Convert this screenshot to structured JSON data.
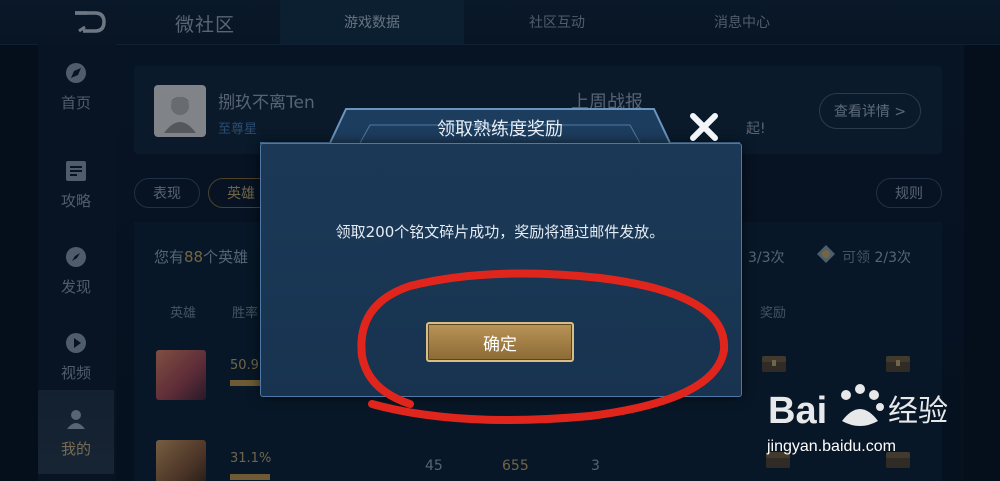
{
  "header": {
    "title": "微社区",
    "tabs": [
      {
        "label": "游戏数据",
        "active": true
      },
      {
        "label": "社区互动",
        "active": false
      },
      {
        "label": "消息中心",
        "active": false
      }
    ]
  },
  "sidebar": {
    "items": [
      {
        "label": "首页",
        "icon": "compass-icon"
      },
      {
        "label": "攻略",
        "icon": "guide-icon"
      },
      {
        "label": "发现",
        "icon": "discover-icon"
      },
      {
        "label": "视频",
        "icon": "play-icon"
      },
      {
        "label": "我的",
        "icon": "user-icon",
        "active": true
      }
    ]
  },
  "profile": {
    "name": "捌玖不离Ten",
    "rank": "至尊星",
    "weekly_title": "上周战报",
    "weekly_sub": "起!",
    "detail_button": "查看详情 >"
  },
  "filters": {
    "chip1": "表现",
    "chip2": "英雄",
    "rules": "规则"
  },
  "panel": {
    "prefix": "您有",
    "hero_count": "88",
    "suffix": "个英雄",
    "count1": "3/3次",
    "count2_label": "可领",
    "count2": "2/3次",
    "columns": {
      "hero": "英雄",
      "winrate": "胜率",
      "reward": "奖励"
    },
    "rows": [
      {
        "winrate": "50.9",
        "c1": "",
        "c2": "",
        "c3": "",
        "reward_state": "已领"
      },
      {
        "winrate": "31.1%",
        "c1": "45",
        "c2": "655",
        "c3": "3",
        "reward_state": ""
      }
    ]
  },
  "modal": {
    "title": "领取熟练度奖励",
    "message": "领取200个铭文碎片成功，奖励将通过邮件发放。",
    "confirm_label": "确定"
  },
  "watermark": {
    "brand": "Bai百经验",
    "url": "jingyan.baidu.com"
  },
  "colors": {
    "accent_gold": "#c9b27a",
    "annotation_red": "#e0261c",
    "modal_bg": "#1b3957"
  }
}
